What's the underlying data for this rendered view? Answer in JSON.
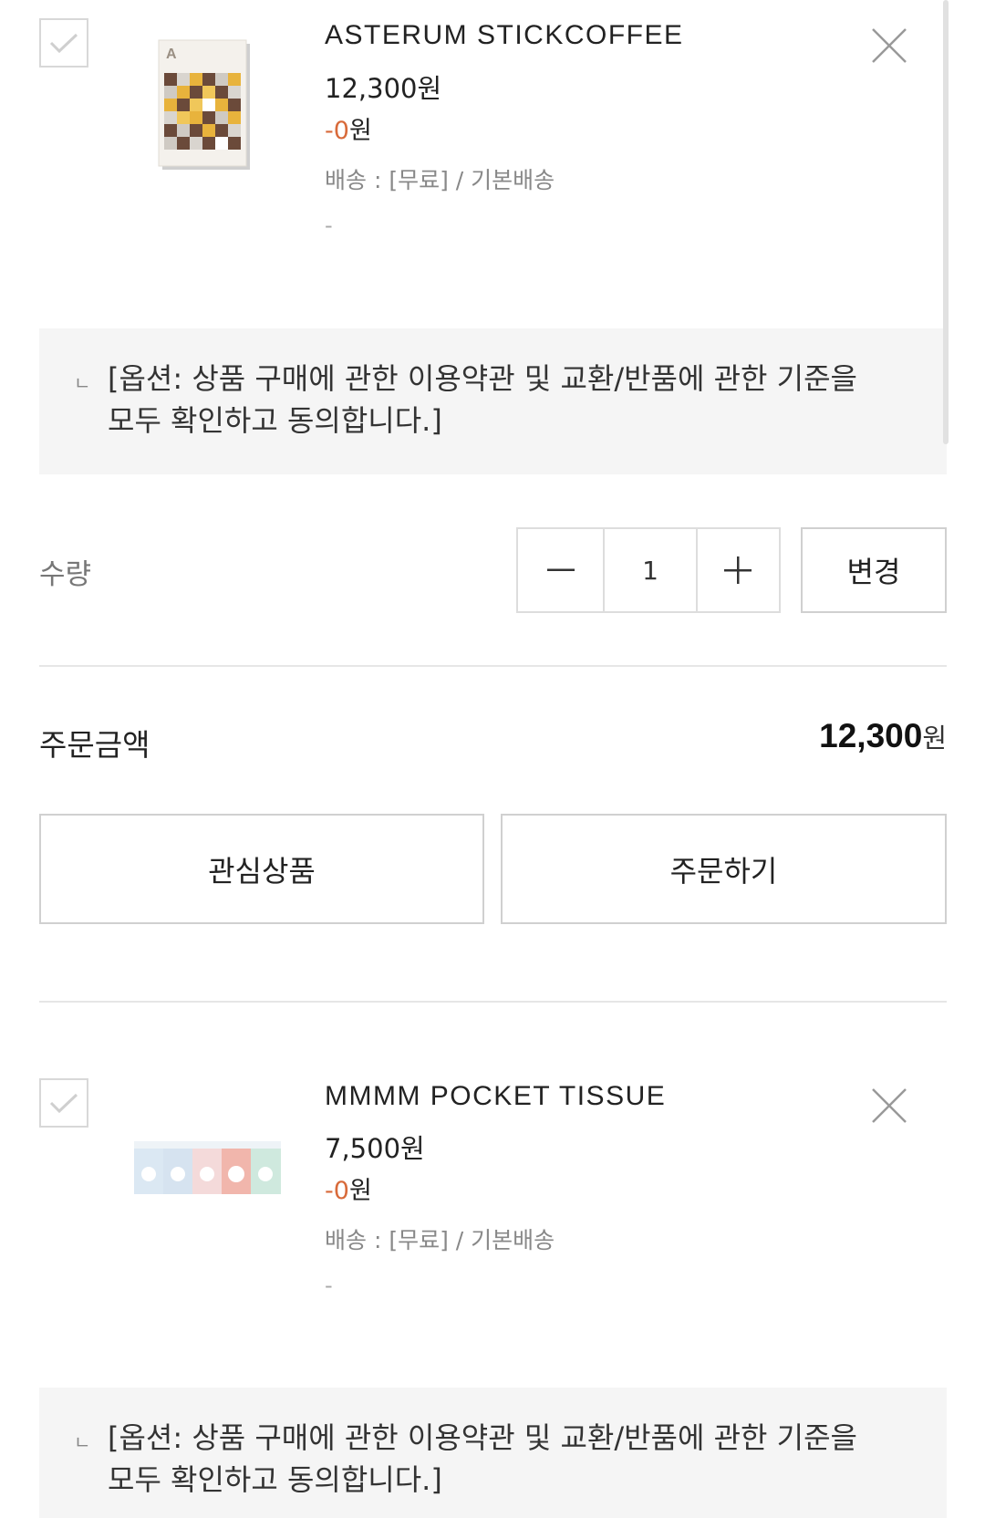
{
  "items": [
    {
      "name": "ASTERUM STICKCOFFEE",
      "price": "12,300원",
      "discount_prefix": "-",
      "discount_value": "0",
      "discount_unit": "원",
      "shipping": "배송 : [무료] / 기본배송",
      "extra": "-",
      "option_mark": "ㄴ",
      "option_line1": "[옵션: 상품 구매에 관한 이용약관 및 교환/반품에 관한 기준을",
      "option_line2": "모두 확인하고 동의합니다.]"
    },
    {
      "name": "MMMM POCKET TISSUE",
      "price": "7,500원",
      "discount_prefix": "-",
      "discount_value": "0",
      "discount_unit": "원",
      "shipping": "배송 : [무료] / 기본배송",
      "extra": "-",
      "option_mark": "ㄴ",
      "option_line1": "[옵션: 상품 구매에 관한 이용약관 및 교환/반품에 관한 기준을",
      "option_line2": "모두 확인하고 동의합니다.]"
    }
  ],
  "quantity": {
    "label": "수량",
    "value": "1",
    "minus": "−",
    "plus": "+",
    "change_label": "변경"
  },
  "order_amount": {
    "label": "주문금액",
    "value": "12,300",
    "unit": "원"
  },
  "buttons": {
    "wishlist": "관심상품",
    "order": "주문하기"
  },
  "colors": {
    "accent": "#d86a3a",
    "border": "#d8d8d8",
    "option_bg": "#f5f5f5"
  }
}
